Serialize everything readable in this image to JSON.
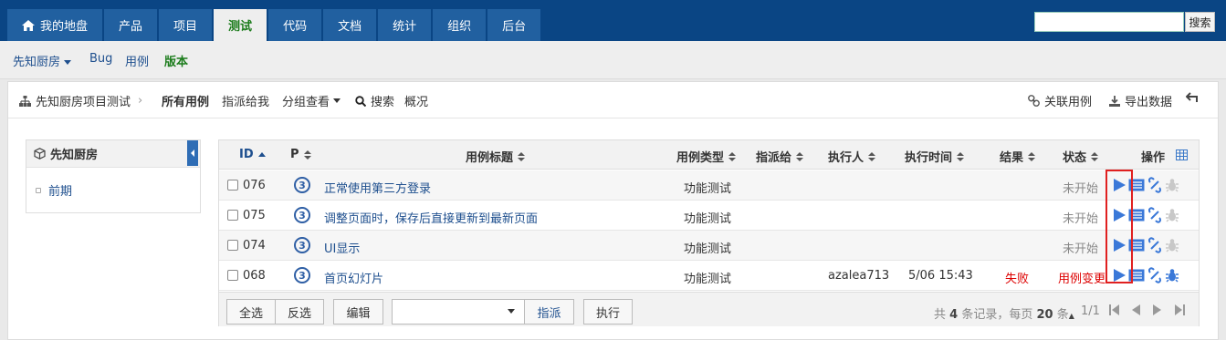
{
  "nav": {
    "tabs": [
      "我的地盘",
      "产品",
      "项目",
      "测试",
      "代码",
      "文档",
      "统计",
      "组织",
      "后台"
    ],
    "active_index": 3,
    "search_button": "搜索"
  },
  "subnav": {
    "product": "先知厨房",
    "bug": "Bug",
    "case": "用例",
    "build": "版本"
  },
  "toolbar": {
    "breadcrumb_project": "先知厨房项目测试",
    "all_cases": "所有用例",
    "assigned_to_me": "指派给我",
    "group_view": "分组查看",
    "search": "搜索",
    "overview": "概况",
    "link_cases": "关联用例",
    "export": "导出数据"
  },
  "side": {
    "title": "先知厨房",
    "item": "前期"
  },
  "table": {
    "headers": {
      "id": "ID",
      "pri": "P",
      "title": "用例标题",
      "type": "用例类型",
      "assigned": "指派给",
      "executor": "执行人",
      "exec_time": "执行时间",
      "result": "结果",
      "status": "状态",
      "actions": "操作"
    },
    "rows": [
      {
        "id": "076",
        "pri": "3",
        "title": "正常使用第三方登录",
        "type": "功能测试",
        "assigned": "",
        "executor": "",
        "exec_time": "",
        "result": "",
        "status": "未开始"
      },
      {
        "id": "075",
        "pri": "3",
        "title": "调整页面时，保存后直接更新到最新页面",
        "type": "功能测试",
        "assigned": "",
        "executor": "",
        "exec_time": "",
        "result": "",
        "status": "未开始"
      },
      {
        "id": "074",
        "pri": "3",
        "title": "UI显示",
        "type": "功能测试",
        "assigned": "",
        "executor": "",
        "exec_time": "",
        "result": "",
        "status": "未开始"
      },
      {
        "id": "068",
        "pri": "3",
        "title": "首页幻灯片",
        "type": "功能测试",
        "assigned": "",
        "executor": "azalea713",
        "exec_time": "5/06 15:43",
        "result": "失败",
        "status": "用例变更"
      }
    ]
  },
  "footer": {
    "select_all": "全选",
    "invert": "反选",
    "edit": "编辑",
    "assign": "指派",
    "execute": "执行",
    "pager_prefix": "共",
    "total": "4",
    "pager_mid": "条记录，每页",
    "per_page": "20",
    "pager_unit": "条",
    "page": "1/1"
  },
  "colors": {
    "nav_bg": "#0a4584",
    "tab_bg": "#2160a0",
    "active_green": "#1c7c1c",
    "link_blue": "#1e4f8e",
    "fail_red": "#dd0000",
    "highlight_red": "#e02020"
  }
}
